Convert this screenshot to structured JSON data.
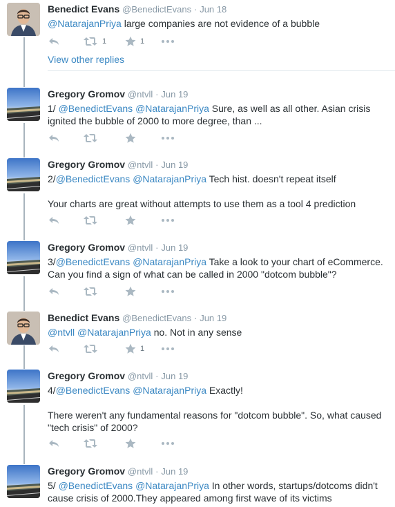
{
  "tweets": [
    {
      "name": "Benedict Evans",
      "handle": "@BenedictEvans",
      "time": "Jun 18",
      "avatar": "person-avatar",
      "text": [
        [
          {
            "m": "@NatarajanPriya"
          },
          {
            "t": " large companies are not evidence of a bubble"
          }
        ]
      ],
      "retweets": "1",
      "likes": "1"
    },
    {
      "name": "Gregory Gromov",
      "handle": "@ntvll",
      "time": "Jun 19",
      "avatar": "landscape-avatar",
      "text": [
        [
          {
            "t": "1/ "
          },
          {
            "m": "@BenedictEvans"
          },
          {
            "t": " "
          },
          {
            "m": "@NatarajanPriya"
          },
          {
            "t": " Sure, as well as all other. Asian crisis ignited the bubble of 2000 to more degree, than ..."
          }
        ]
      ],
      "retweets": "",
      "likes": ""
    },
    {
      "name": "Gregory Gromov",
      "handle": "@ntvll",
      "time": "Jun 19",
      "avatar": "landscape-avatar",
      "text": [
        [
          {
            "t": "2/"
          },
          {
            "m": "@BenedictEvans"
          },
          {
            "t": " "
          },
          {
            "m": "@NatarajanPriya"
          },
          {
            "t": " Tech hist. doesn't repeat itself"
          }
        ],
        [
          {
            "t": "Your charts are great without attempts to use them as a tool 4 prediction"
          }
        ]
      ],
      "retweets": "",
      "likes": ""
    },
    {
      "name": "Gregory Gromov",
      "handle": "@ntvll",
      "time": "Jun 19",
      "avatar": "landscape-avatar",
      "text": [
        [
          {
            "t": "3/"
          },
          {
            "m": "@BenedictEvans"
          },
          {
            "t": " "
          },
          {
            "m": "@NatarajanPriya"
          },
          {
            "t": " Take a look to your chart of eCommerce. Can you find a sign of what can be called in 2000 \"dotcom bubble\"?"
          }
        ]
      ],
      "retweets": "",
      "likes": ""
    },
    {
      "name": "Benedict Evans",
      "handle": "@BenedictEvans",
      "time": "Jun 19",
      "avatar": "person-avatar",
      "text": [
        [
          {
            "m": "@ntvll"
          },
          {
            "t": " "
          },
          {
            "m": "@NatarajanPriya"
          },
          {
            "t": " no. Not in any sense"
          }
        ]
      ],
      "retweets": "",
      "likes": "1"
    },
    {
      "name": "Gregory Gromov",
      "handle": "@ntvll",
      "time": "Jun 19",
      "avatar": "landscape-avatar",
      "text": [
        [
          {
            "t": "4/"
          },
          {
            "m": "@BenedictEvans"
          },
          {
            "t": " "
          },
          {
            "m": "@NatarajanPriya"
          },
          {
            "t": " Exactly!"
          }
        ],
        [
          {
            "t": "There weren't any fundamental reasons for \"dotcom bubble\". So, what caused \"tech crisis\" of 2000?"
          }
        ]
      ],
      "retweets": "",
      "likes": ""
    },
    {
      "name": "Gregory Gromov",
      "handle": "@ntvll",
      "time": "Jun 19",
      "avatar": "landscape-avatar",
      "text": [
        [
          {
            "t": "5/ "
          },
          {
            "m": "@BenedictEvans"
          },
          {
            "t": " "
          },
          {
            "m": "@NatarajanPriya"
          },
          {
            "t": " In other words, startups/dotcoms didn't cause crisis of 2000.They appeared among first wave of its victims"
          }
        ]
      ],
      "retweets": "",
      "likes": ""
    }
  ],
  "view_other_replies": "View other replies",
  "header_separator": "·",
  "colors": {
    "mention": "#3b88c3",
    "action_icon": "#aab8c2",
    "thread_line": "#a8b4bd"
  },
  "icons": [
    "reply-icon",
    "retweet-icon",
    "like-icon",
    "more-icon"
  ]
}
